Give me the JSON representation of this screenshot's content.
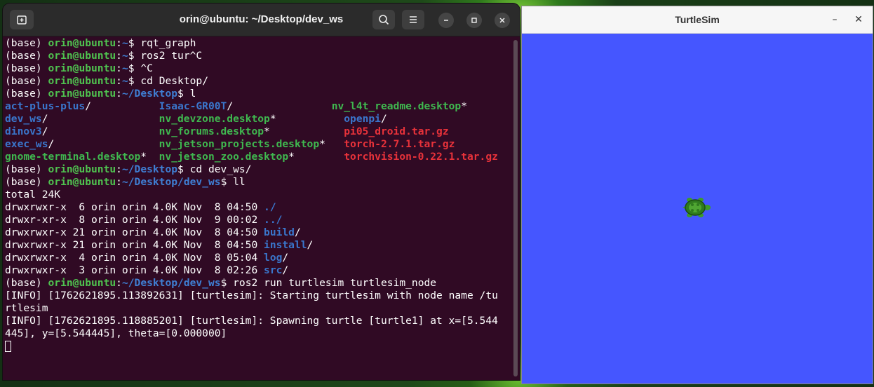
{
  "terminal": {
    "title": "orin@ubuntu: ~/Desktop/dev_ws",
    "lines": [
      [
        [
          "(base) ",
          ""
        ],
        [
          "orin@ubuntu",
          "u"
        ],
        [
          ":",
          ""
        ],
        [
          "~",
          "p"
        ],
        [
          "$ rqt_graph",
          ""
        ]
      ],
      [
        [
          "(base) ",
          ""
        ],
        [
          "orin@ubuntu",
          "u"
        ],
        [
          ":",
          ""
        ],
        [
          "~",
          "p"
        ],
        [
          "$ ros2 tur^C",
          ""
        ]
      ],
      [
        [
          "(base) ",
          ""
        ],
        [
          "orin@ubuntu",
          "u"
        ],
        [
          ":",
          ""
        ],
        [
          "~",
          "p"
        ],
        [
          "$ ^C",
          ""
        ]
      ],
      [
        [
          "(base) ",
          ""
        ],
        [
          "orin@ubuntu",
          "u"
        ],
        [
          ":",
          ""
        ],
        [
          "~",
          "p"
        ],
        [
          "$ cd Desktop/",
          ""
        ]
      ],
      [
        [
          "(base) ",
          ""
        ],
        [
          "orin@ubuntu",
          "u"
        ],
        [
          ":",
          ""
        ],
        [
          "~/Desktop",
          "p"
        ],
        [
          "$ l",
          ""
        ]
      ],
      [
        [
          "act-plus-plus",
          "d"
        ],
        [
          "/           ",
          ""
        ],
        [
          "Isaac-GR00T",
          "d"
        ],
        [
          "/                ",
          ""
        ],
        [
          "nv_l4t_readme.desktop",
          "x"
        ],
        [
          "*",
          ""
        ]
      ],
      [
        [
          "dev_ws",
          "d"
        ],
        [
          "/                  ",
          ""
        ],
        [
          "nv_devzone.desktop",
          "x"
        ],
        [
          "*           ",
          ""
        ],
        [
          "openpi",
          "d"
        ],
        [
          "/",
          ""
        ]
      ],
      [
        [
          "dinov3",
          "d"
        ],
        [
          "/                  ",
          ""
        ],
        [
          "nv_forums.desktop",
          "x"
        ],
        [
          "*            ",
          ""
        ],
        [
          "pi05_droid.tar.gz",
          "a"
        ]
      ],
      [
        [
          "exec_ws",
          "d"
        ],
        [
          "/                 ",
          ""
        ],
        [
          "nv_jetson_projects.desktop",
          "x"
        ],
        [
          "*   ",
          ""
        ],
        [
          "torch-2.7.1.tar.gz",
          "a"
        ]
      ],
      [
        [
          "gnome-terminal.desktop",
          "x"
        ],
        [
          "*  ",
          ""
        ],
        [
          "nv_jetson_zoo.desktop",
          "x"
        ],
        [
          "*        ",
          ""
        ],
        [
          "torchvision-0.22.1.tar.gz",
          "a"
        ]
      ],
      [
        [
          "(base) ",
          ""
        ],
        [
          "orin@ubuntu",
          "u"
        ],
        [
          ":",
          ""
        ],
        [
          "~/Desktop",
          "p"
        ],
        [
          "$ cd dev_ws/",
          ""
        ]
      ],
      [
        [
          "(base) ",
          ""
        ],
        [
          "orin@ubuntu",
          "u"
        ],
        [
          ":",
          ""
        ],
        [
          "~/Desktop/dev_ws",
          "p"
        ],
        [
          "$ ll",
          ""
        ]
      ],
      [
        [
          "total 24K",
          ""
        ]
      ],
      [
        [
          "drwxrwxr-x  6 orin orin 4.0K Nov  8 04:50 ",
          ""
        ],
        [
          "./",
          "d"
        ]
      ],
      [
        [
          "drwxr-xr-x  8 orin orin 4.0K Nov  9 00:02 ",
          ""
        ],
        [
          "../",
          "d"
        ]
      ],
      [
        [
          "drwxrwxr-x 21 orin orin 4.0K Nov  8 04:50 ",
          ""
        ],
        [
          "build",
          "d"
        ],
        [
          "/",
          ""
        ]
      ],
      [
        [
          "drwxrwxr-x 21 orin orin 4.0K Nov  8 04:50 ",
          ""
        ],
        [
          "install",
          "d"
        ],
        [
          "/",
          ""
        ]
      ],
      [
        [
          "drwxrwxr-x  4 orin orin 4.0K Nov  8 05:04 ",
          ""
        ],
        [
          "log",
          "d"
        ],
        [
          "/",
          ""
        ]
      ],
      [
        [
          "drwxrwxr-x  3 orin orin 4.0K Nov  8 02:26 ",
          ""
        ],
        [
          "src",
          "d"
        ],
        [
          "/",
          ""
        ]
      ],
      [
        [
          "(base) ",
          ""
        ],
        [
          "orin@ubuntu",
          "u"
        ],
        [
          ":",
          ""
        ],
        [
          "~/Desktop/dev_ws",
          "p"
        ],
        [
          "$ ros2 run turtlesim turtlesim_node",
          ""
        ]
      ],
      [
        [
          "[INFO] [1762621895.113892631] [turtlesim]: Starting turtlesim with node name /tu",
          ""
        ]
      ],
      [
        [
          "rtlesim",
          ""
        ]
      ],
      [
        [
          "[INFO] [1762621895.118885201] [turtlesim]: Spawning turtle [turtle1] at x=[5.544",
          ""
        ]
      ],
      [
        [
          "445], y=[5.544445], theta=[0.000000]",
          ""
        ]
      ]
    ]
  },
  "turtlesim": {
    "title": "TurtleSim",
    "canvas_color": "#4556ff"
  },
  "icons": {
    "new_tab": "new-tab-icon",
    "search": "search-icon",
    "menu": "hamburger-menu-icon",
    "minimize": "minimize-icon",
    "maximize": "maximize-icon",
    "close": "close-icon"
  },
  "glyphs": {
    "minimize": "–",
    "close": "✕"
  }
}
